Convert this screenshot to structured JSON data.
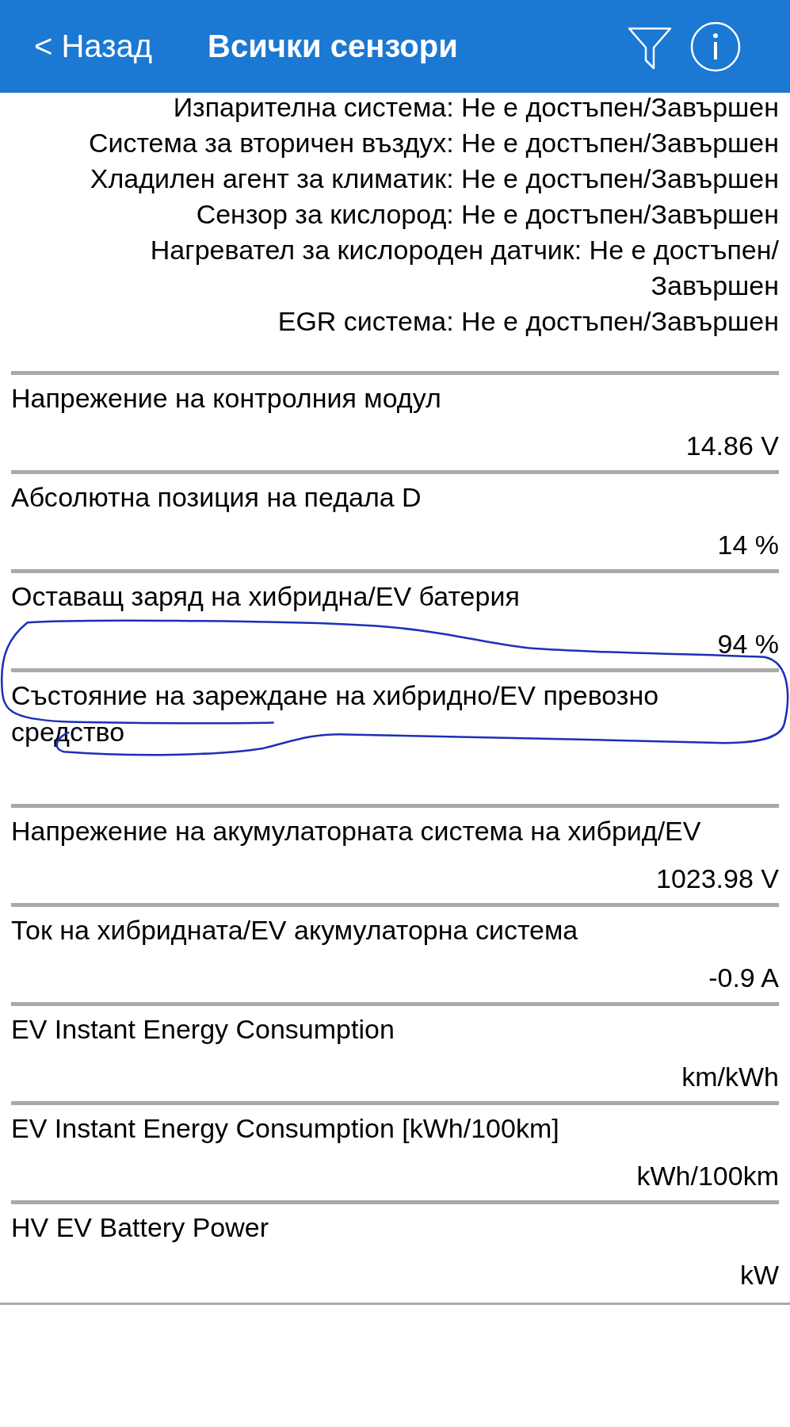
{
  "header": {
    "back_label": "< Назад",
    "title": "Всички сензори"
  },
  "status_lines": [
    "Изпарителна система: Не е достъпен/Завършен",
    "Система за вторичен въздух: Не е достъпен/Завършен",
    "Хладилен агент за климатик: Не е достъпен/Завършен",
    "Сензор за кислород: Не е достъпен/Завършен",
    "Нагревател за кислороден датчик: Не е достъпен/Завършен",
    "EGR система: Не е достъпен/Завършен"
  ],
  "sensors": [
    {
      "label": "Напрежение на контролния модул",
      "value": "14.86 V"
    },
    {
      "label": "Абсолютна позиция на педала D",
      "value": "14 %"
    },
    {
      "label": "Оставащ заряд на хибридна/EV батерия",
      "value": "94 %"
    },
    {
      "label": "Състояние на зареждане на хибридно/EV превозно средство"
    },
    {
      "label": "Напрежение на акумулаторната система на хибрид/EV",
      "value": "1023.98 V"
    },
    {
      "label": "Ток на хибридната/EV акумулаторна система",
      "value": "-0.9 A"
    },
    {
      "label": "EV Instant Energy Consumption",
      "value": "km/kWh"
    },
    {
      "label": "EV Instant Energy Consumption [kWh/100km]",
      "value": "kWh/100km"
    },
    {
      "label": "HV EV Battery Power",
      "value": "kW"
    }
  ]
}
